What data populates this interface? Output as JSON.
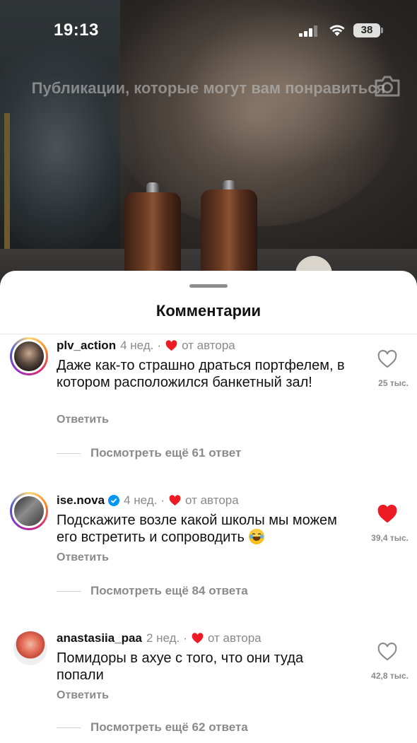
{
  "status_bar": {
    "time": "19:13",
    "battery": "38"
  },
  "background": {
    "suggestions_title": "Публикации, которые могут вам понравиться"
  },
  "comments_sheet": {
    "title": "Комментарии",
    "comments": [
      {
        "username": "plv_action",
        "verified": false,
        "age": "4 нед.",
        "separator": "·",
        "liked_by_author": "от автора",
        "text": "Даже как-то страшно драться портфелем, в котором расположился банкетный зал!",
        "reply_label": "Ответить",
        "likes": "25 тыс.",
        "liked_by_me": false,
        "view_replies": "Посмотреть ещё 61 ответ"
      },
      {
        "username": "ise.nova",
        "verified": true,
        "age": "4 нед.",
        "separator": "·",
        "liked_by_author": "от автора",
        "text": "Подскажите возле какой школы мы можем его встретить и сопроводить",
        "emoji": "face-with-tears-of-joy",
        "reply_label": "Ответить",
        "likes": "39,4 тыс.",
        "liked_by_me": true,
        "view_replies": "Посмотреть ещё 84 ответа"
      },
      {
        "username": "anastasiia_paa",
        "verified": false,
        "age": "2 нед.",
        "separator": "·",
        "liked_by_author": "от автора",
        "text": "Помидоры в ахуе с того, что они туда попали",
        "reply_label": "Ответить",
        "likes": "42,8 тыс.",
        "liked_by_me": false,
        "view_replies": "Посмотреть ещё 62 ответа"
      }
    ]
  },
  "colors": {
    "heart_red": "#ed1c24",
    "verified_blue": "#0095f6",
    "secondary_text": "#8a8a8a"
  }
}
